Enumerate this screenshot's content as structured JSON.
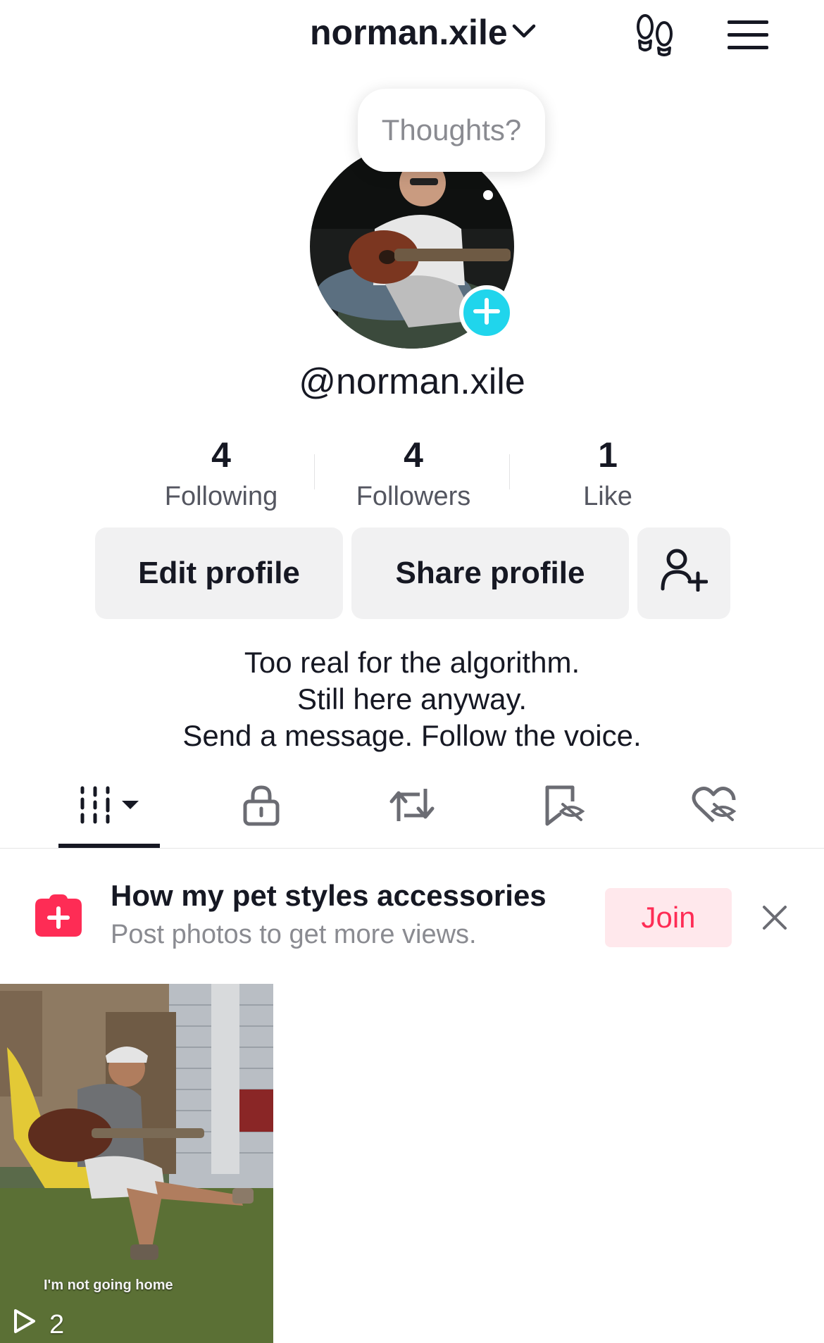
{
  "header": {
    "username": "norman.xile",
    "dropdown_icon": "chevron-down-icon",
    "footprints_icon": "footprints-icon",
    "menu_icon": "hamburger-menu-icon"
  },
  "profile": {
    "bubble_text": "Thoughts?",
    "handle": "@norman.xile",
    "add_icon": "plus-icon",
    "accent_color": "#20d5ec"
  },
  "stats": [
    {
      "value": "4",
      "label": "Following"
    },
    {
      "value": "4",
      "label": "Followers"
    },
    {
      "value": "1",
      "label": "Like"
    }
  ],
  "actions": {
    "edit_label": "Edit profile",
    "share_label": "Share profile",
    "add_friend_icon": "add-friend-icon"
  },
  "bio": {
    "line1": "Too real for the algorithm.",
    "line2": "Still here anyway.",
    "line3": "Send a message. Follow the voice."
  },
  "tabs": [
    {
      "name": "videos-grid",
      "icon": "grid-bars-icon",
      "active": true
    },
    {
      "name": "private",
      "icon": "lock-icon"
    },
    {
      "name": "reposts",
      "icon": "repost-icon"
    },
    {
      "name": "favorites",
      "icon": "bookmark-hidden-icon"
    },
    {
      "name": "liked",
      "icon": "heart-hidden-icon"
    }
  ],
  "promo": {
    "title": "How my pet styles accessories",
    "subtitle": "Post photos to get more views.",
    "join_label": "Join",
    "brand_color": "#fe2c55"
  },
  "videos": [
    {
      "caption": "I'm not going home",
      "plays": "2"
    }
  ]
}
